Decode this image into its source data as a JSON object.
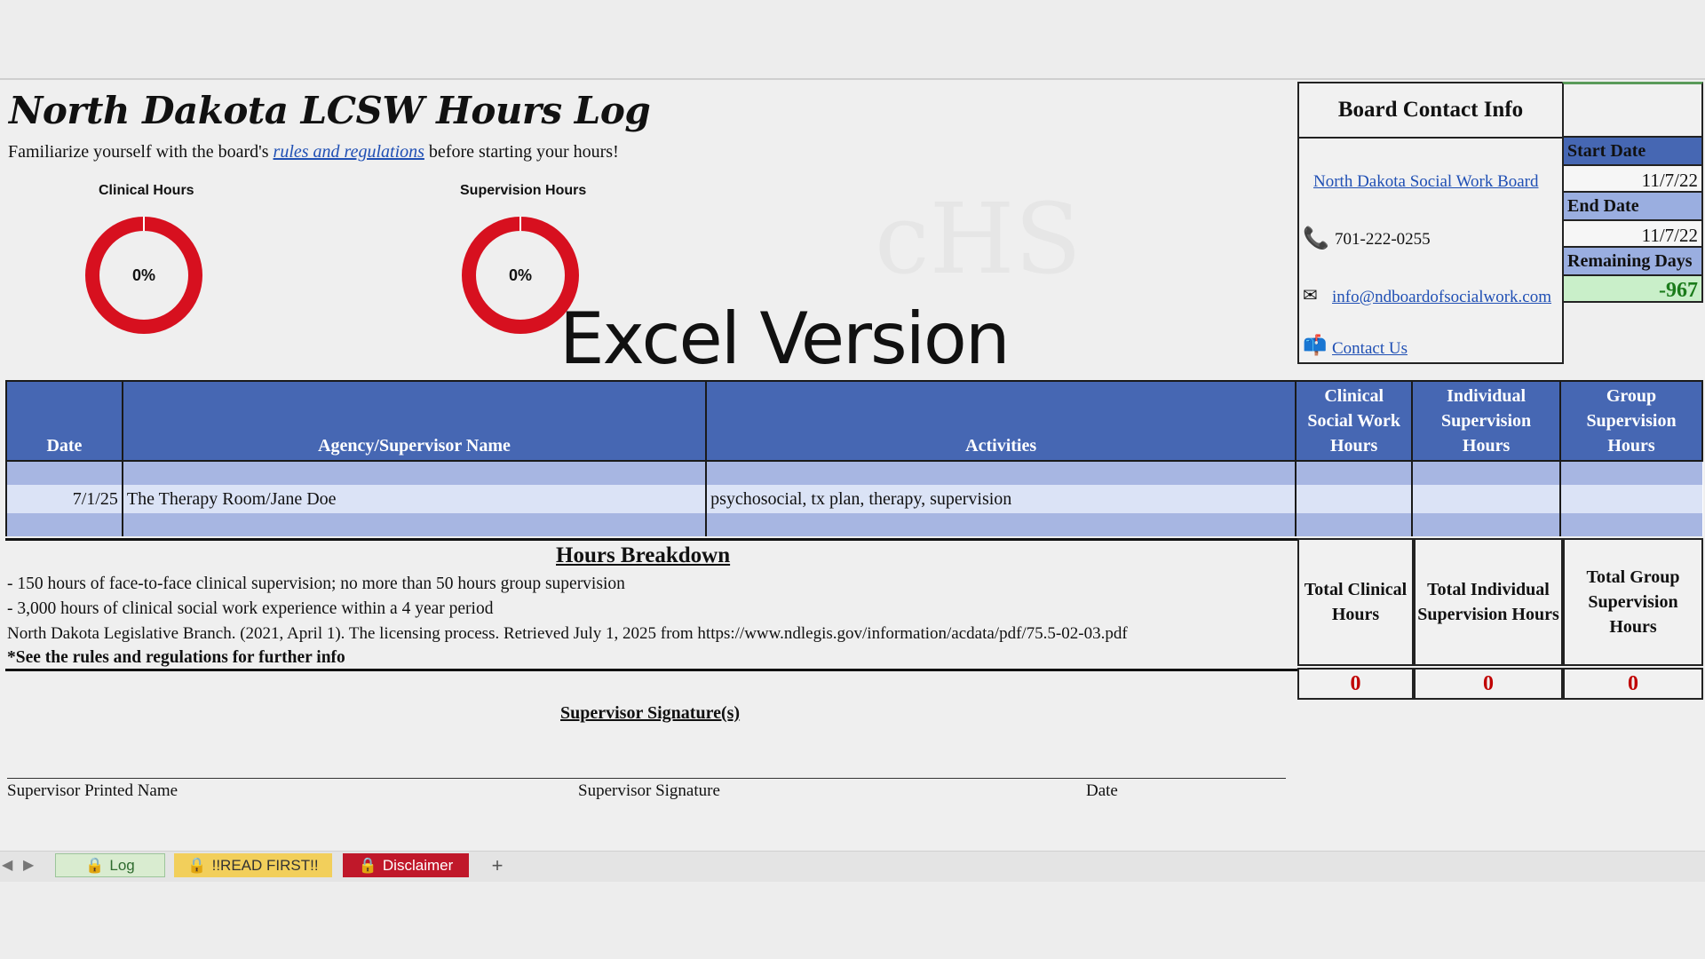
{
  "header": {
    "title": "North Dakota LCSW Hours Log",
    "subtitle_before": "Familiarize yourself with the board's ",
    "subtitle_link": "rules and regulations",
    "subtitle_after": " before starting your hours!",
    "watermark": "Excel Version"
  },
  "gauges": [
    {
      "title": "Clinical Hours",
      "percent_label": "0%",
      "value": 0
    },
    {
      "title": "Supervision Hours",
      "percent_label": "0%",
      "value": 0
    }
  ],
  "contact": {
    "heading": "Board Contact Info",
    "board_link": "North Dakota Social Work Board",
    "phone": "701-222-0255",
    "email": "info@ndboardofsocialwork.com",
    "contact_us": "Contact Us"
  },
  "dates": {
    "start_label": "Start Date",
    "start_value": "11/7/22",
    "end_label": "End Date",
    "end_value": "11/7/22",
    "remaining_label": "Remaining Days",
    "remaining_value": "-967"
  },
  "log": {
    "columns": [
      "Date",
      "Agency/Supervisor Name",
      "Activities",
      "Clinical Social Work Hours",
      "Individual Supervision Hours",
      "Group Supervision Hours"
    ],
    "rows": [
      {
        "date": "",
        "agency": "",
        "activities": "",
        "clinical": "",
        "individual": "",
        "group": ""
      },
      {
        "date": "7/1/25",
        "agency": "The Therapy Room/Jane Doe",
        "activities": "psychosocial, tx plan, therapy, supervision",
        "clinical": "",
        "individual": "",
        "group": ""
      },
      {
        "date": "",
        "agency": "",
        "activities": "",
        "clinical": "",
        "individual": "",
        "group": ""
      }
    ]
  },
  "breakdown": {
    "title": "Hours Breakdown",
    "lines": [
      "- 150 hours of face-to-face clinical supervision; no more than 50 hours group supervision",
      "- 3,000 hours of clinical social work experience within a 4 year period",
      "North Dakota Legislative Branch. (2021, April 1). The licensing process. Retrieved July 1, 2025 from https://www.ndlegis.gov/information/acdata/pdf/75.5-02-03.pdf",
      "*See the rules and regulations for further info"
    ]
  },
  "totals": {
    "clinical_label": "Total Clinical Hours",
    "individual_label": "Total Individual Supervision Hours",
    "group_label": "Total Group Supervision Hours",
    "clinical_value": "0",
    "individual_value": "0",
    "group_value": "0"
  },
  "signature": {
    "title": "Supervisor Signature(s)",
    "printed_name": "Supervisor Printed Name",
    "signature": "Supervisor Signature",
    "date": "Date"
  },
  "tabs": [
    {
      "label": "Log",
      "color": "#d9ecd0"
    },
    {
      "label": "!!READ FIRST!!",
      "color": "#f2cf5b"
    },
    {
      "label": "Disclaimer",
      "color": "#c0182a"
    }
  ],
  "tab_add": "+",
  "colors": {
    "header_blue": "#4667b3",
    "gauge_red": "#d7101f",
    "total_red": "#c00000"
  }
}
